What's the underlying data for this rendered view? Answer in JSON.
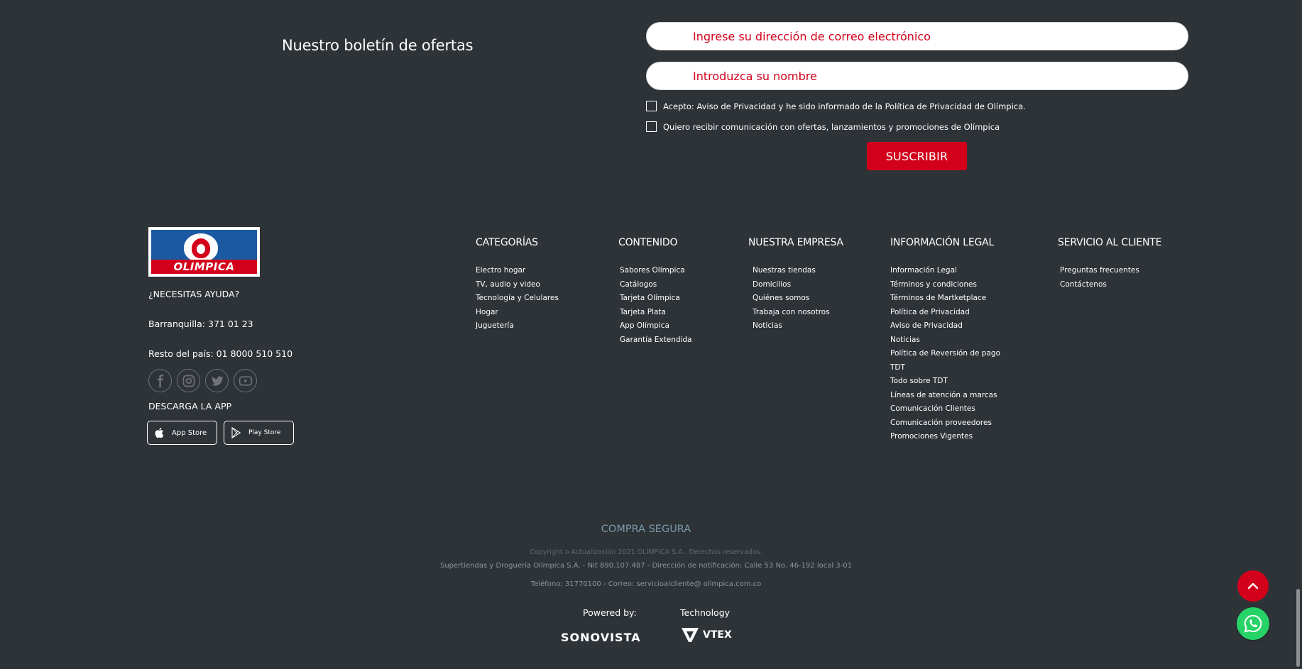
{
  "newsletter": {
    "title": "Nuestro boletín de ofertas",
    "email_placeholder": "Ingrese su dirección de correo electrónico",
    "name_placeholder": "Introduzca su nombre",
    "privacy_label": "Acepto: Aviso de Privacidad y he sido informado de la Política de Privacidad de Olímpica.",
    "offers_label": "Quiero recibir comunicación con ofertas, lanzamientos y promociones de Olímpica",
    "subscribe_label": "SUSCRIBIR"
  },
  "brand": {
    "logo_text": "OLIMPICA",
    "help_heading": "¿NECESITAS AYUDA?",
    "phone_barranquilla": "Barranquilla: 371 01 23",
    "phone_country": "Resto del país: 01 8000 510 510",
    "download_app": "DESCARGA LA APP",
    "app_store": "App Store",
    "play_store": "Play Store",
    "social_icons": [
      "facebook-icon",
      "instagram-icon",
      "twitter-icon",
      "youtube-icon"
    ]
  },
  "columns": {
    "categorias": {
      "heading": "CATEGORÍAS",
      "items": [
        "Electro hogar",
        "TV, audio y video",
        "Tecnología y Celulares",
        "Hogar",
        "Juguetería"
      ]
    },
    "contenido": {
      "heading": "CONTENIDO",
      "items": [
        "Sabores Olímpica",
        "Catálogos",
        "Tarjeta Olímpica",
        "Tarjeta Plata",
        "App Olímpica",
        "Garantía Extendida"
      ]
    },
    "empresa": {
      "heading": "NUESTRA EMPRESA",
      "items": [
        "Nuestras tiendas",
        "Domicilios",
        "Quiénes somos",
        "Trabaja con nosotros",
        "Noticias"
      ]
    },
    "legal": {
      "heading": "INFORMACIÓN LEGAL",
      "items": [
        "Información Legal",
        "Términos y condiciones",
        "Términos de Martketplace",
        "Política de Privacidad",
        "Aviso de Privacidad",
        "Noticias",
        "Política de Reversión de pago",
        "TDT",
        "Todo sobre TDT",
        "Líneas de atención a marcas",
        "Comunicación Clientes",
        "Comunicación proveedores",
        "Promociones Vigentes"
      ]
    },
    "servicio": {
      "heading": "SERVICIO AL CLIENTE",
      "items": [
        "Preguntas frecuentes",
        "Contáctenos"
      ]
    }
  },
  "bottom": {
    "secure": "COMPRA SEGURA",
    "copyright": "Copyright o Actualización 2021 OLÍMPICA S.A.. Derechos reservados.",
    "company": "Supertiendas y Droguería Olímpica S.A. - Nit 890.107.487 - Dirección de notificación: Calle 53 No. 46-192 local 3-01",
    "contact": "Teléfono: 3177010­0 - Correo: servicioalcliente@ olimpica.com.co",
    "powered_by": "Powered by:",
    "technology": "Technology",
    "sonovista": "SONOVISTA",
    "vtex": "VTEX"
  },
  "colors": {
    "background": "#2e3338",
    "accent_red": "#d3001b",
    "whatsapp_green": "#25d366",
    "logo_blue": "#1b5aa2"
  }
}
